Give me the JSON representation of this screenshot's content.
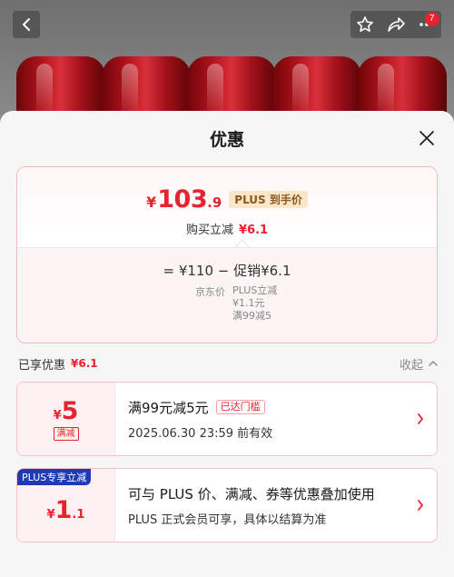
{
  "nav": {
    "badge_count": "7",
    "back_icon": "chevron-left-icon",
    "icons": [
      "star-icon",
      "share-icon",
      "more-icon"
    ]
  },
  "sheet": {
    "title": "优惠",
    "close_icon": "close-icon"
  },
  "price": {
    "yen": "¥",
    "integer": "103",
    "decimal": ".9",
    "plus_tag": "PLUS 到手价",
    "discount_label": "购买立减",
    "discount_value": "¥6.1"
  },
  "calc": {
    "line": "= ¥110 − 促销¥6.1",
    "jd_price_label": "京东价",
    "promo_line1": "PLUS立减",
    "promo_line2": "¥1.1元",
    "promo_line3": "满99减5"
  },
  "enjoyed": {
    "label": "已享优惠",
    "value": "¥6.1",
    "collapse": "收起"
  },
  "coupons": [
    {
      "yen": "¥",
      "amount": "5",
      "amount_decimal": "",
      "tag": "满减",
      "title": "满99元减5元",
      "status": "已达门槛",
      "subtitle": "2025.06.30 23:59 前有效"
    },
    {
      "corner": "PLUS专享立减",
      "yen": "¥",
      "amount": "1",
      "amount_decimal": ".1",
      "title": "可与 PLUS 价、满减、券等优惠叠加使用",
      "subtitle": "PLUS 正式会员可享，具体以结算为准"
    }
  ],
  "colors": {
    "accent_red": "#e8232f",
    "plus_blue": "#1f3bb3",
    "plus_gold_bg": "#fbe6c9"
  }
}
